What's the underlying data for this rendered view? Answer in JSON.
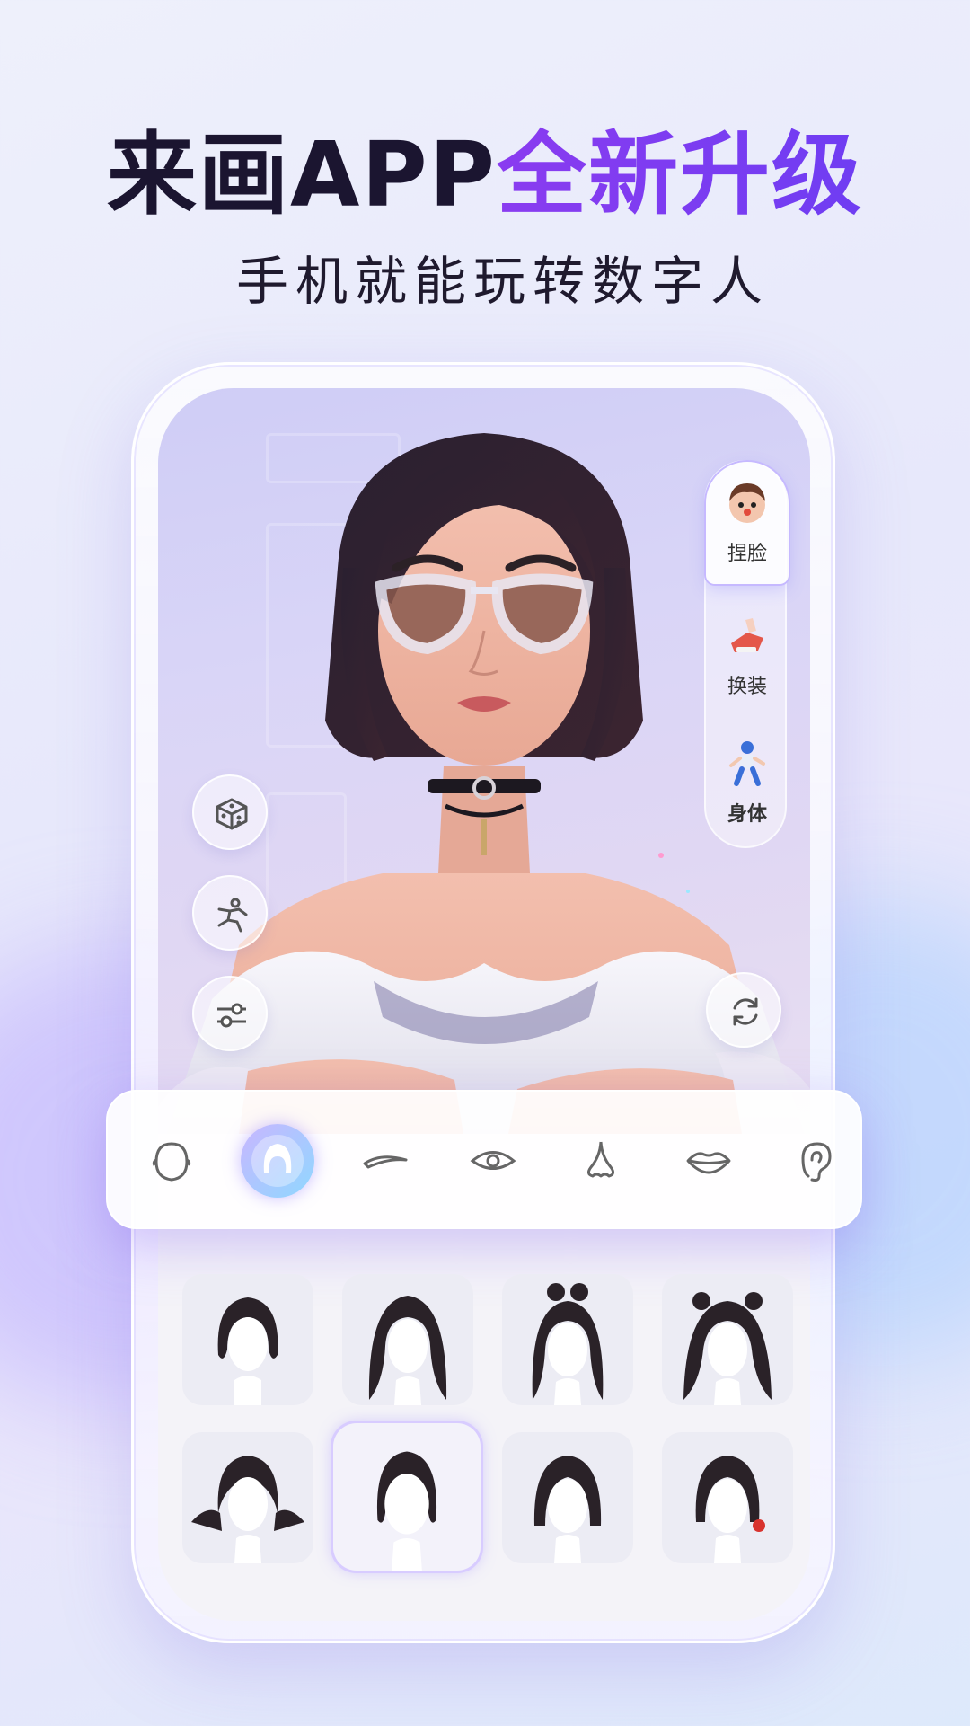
{
  "headline": {
    "part1": "来画APP",
    "part2": "全新升级"
  },
  "subline": "手机就能玩转数字人",
  "side_tabs": [
    {
      "label": "捏脸",
      "icon": "face-sculpt-icon",
      "active": true
    },
    {
      "label": "换装",
      "icon": "outfit-icon",
      "active": false
    },
    {
      "label": "身体",
      "icon": "body-icon",
      "active": false
    }
  ],
  "left_buttons": [
    "dice-random-icon",
    "pose-icon",
    "sliders-adjust-icon"
  ],
  "right_button": "rotate-refresh-icon",
  "feature_bar": {
    "items": [
      {
        "name": "face-shape-icon",
        "active": false
      },
      {
        "name": "hair-icon",
        "active": true
      },
      {
        "name": "eyebrow-icon",
        "active": false
      },
      {
        "name": "eye-icon",
        "active": false
      },
      {
        "name": "nose-icon",
        "active": false
      },
      {
        "name": "lips-icon",
        "active": false
      },
      {
        "name": "ear-icon",
        "active": false
      }
    ]
  },
  "hair_options": {
    "count": 8,
    "selected_index": 5
  },
  "colors": {
    "accent_purple": "#7a3cf0",
    "headline_dark": "#1b1530",
    "active_gradient_start": "#c9b6ff",
    "active_gradient_end": "#8fd8ff"
  }
}
